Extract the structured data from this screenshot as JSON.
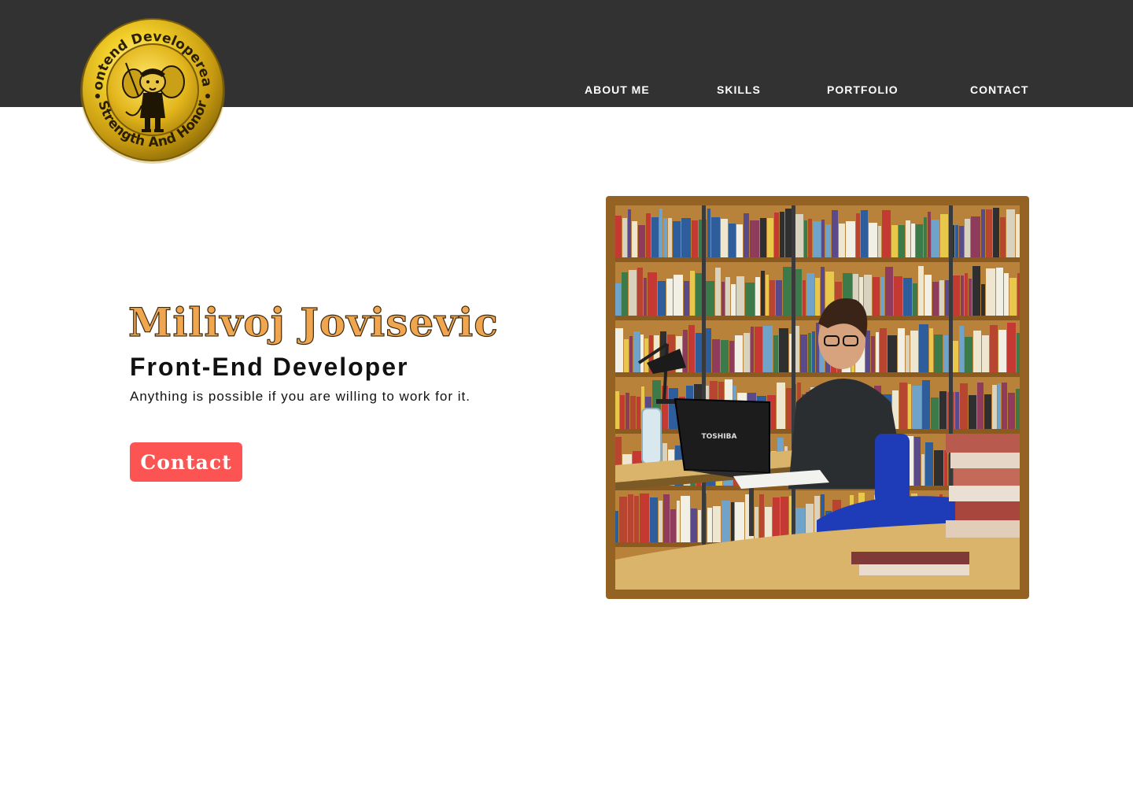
{
  "header": {
    "logo": {
      "top_text": "Frontend Developereaux",
      "bottom_text": "Strength And Honor",
      "colors": {
        "gold": "#d9b21d",
        "gold_light": "#f8e26a",
        "gold_dark": "#8a6a08"
      }
    },
    "nav": [
      {
        "label": "ABOUT ME"
      },
      {
        "label": "SKILLS"
      },
      {
        "label": "PORTFOLIO"
      },
      {
        "label": "CONTACT"
      }
    ],
    "colors": {
      "background": "#333233",
      "text": "#ffffff"
    }
  },
  "hero": {
    "name": "Milivoj Jovisevic",
    "role": "Front-End Developer",
    "motto": "Anything is possible if you are willing to work for it.",
    "cta_label": "Contact",
    "colors": {
      "name": "#f0a64e",
      "cta_background": "#fc5452",
      "text": "#111111"
    }
  },
  "photo": {
    "laptop_brand": "TOSHIBA",
    "colors": {
      "frame": "#946323"
    }
  }
}
